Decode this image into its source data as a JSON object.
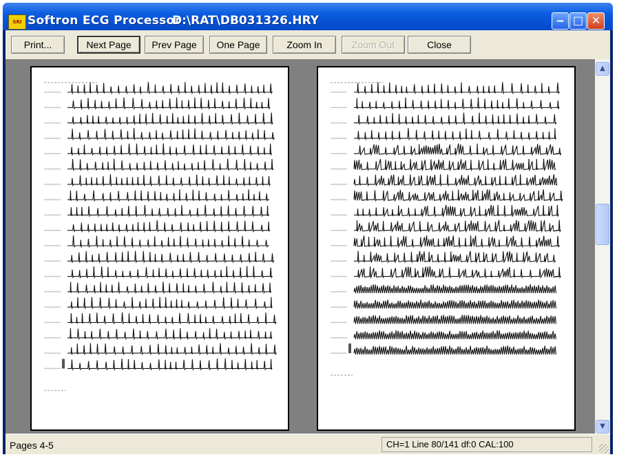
{
  "window": {
    "app_title": "Softron ECG Processor",
    "file_path": "D:\\RAT\\DB031326.HRY",
    "icon_label": "SRI"
  },
  "toolbar": {
    "buttons": [
      {
        "label": "Print...",
        "enabled": true
      },
      {
        "label": "Next Page",
        "enabled": true,
        "focused": true
      },
      {
        "label": "Prev Page",
        "enabled": true
      },
      {
        "label": "One Page",
        "enabled": true
      },
      {
        "label": "Zoom In",
        "enabled": true
      },
      {
        "label": "Zoom Out",
        "enabled": false
      },
      {
        "label": "Close",
        "enabled": true
      }
    ]
  },
  "pages": {
    "left": {
      "line_count": 19,
      "style": "regular"
    },
    "right": {
      "line_count": 18,
      "style": "dense"
    }
  },
  "status": {
    "pages": "Pages 4-5",
    "info": "CH=1 Line 80/141 df:0 CAL:100"
  },
  "colors": {
    "title_bar": "#0a5ce0",
    "chrome": "#ece9d8",
    "viewport_bg": "#808080",
    "close_button": "#d0401c"
  }
}
